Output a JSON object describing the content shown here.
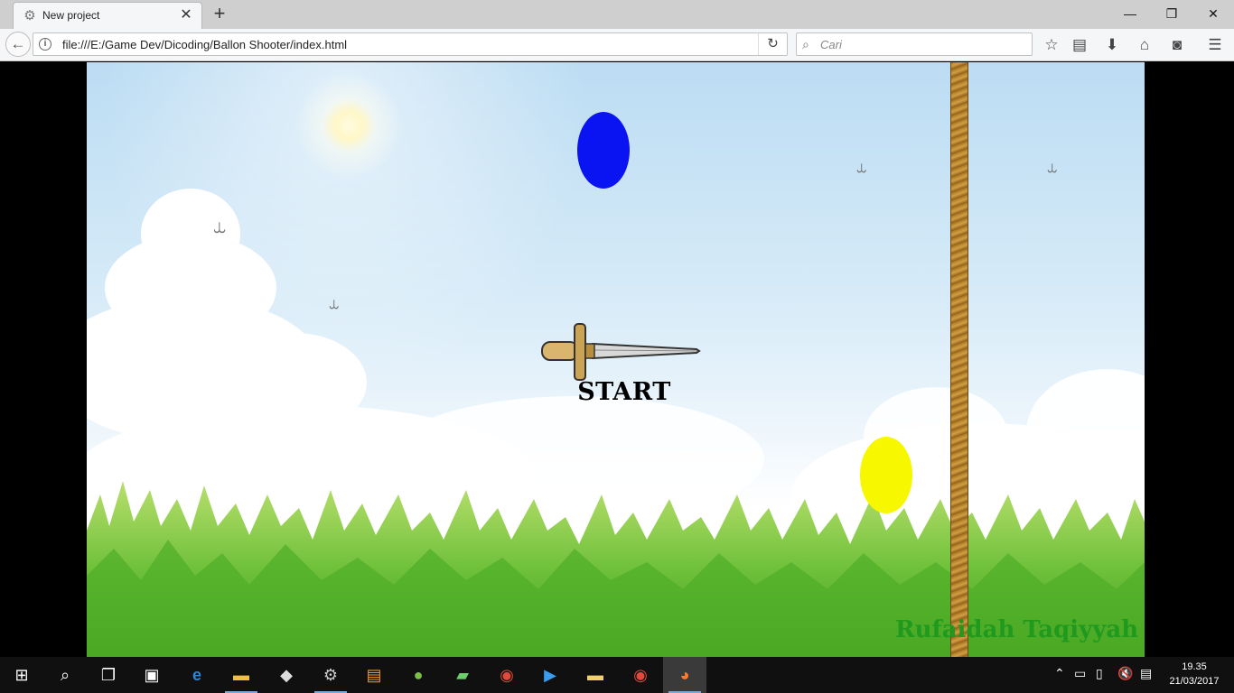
{
  "browser": {
    "tab_title": "New project",
    "tab_icon": "gear-icon",
    "url": "file:///E:/Game Dev/Dicoding/Ballon Shooter/index.html",
    "search_placeholder": "Cari",
    "toolbar_icons": [
      "star-icon",
      "reading-list-icon",
      "download-icon",
      "home-icon",
      "pocket-icon",
      "menu-icon"
    ]
  },
  "game": {
    "start_label": "START",
    "author": "Rufaidah Taqiyyah",
    "balloons": [
      {
        "color": "#0a14f2",
        "name": "blue"
      },
      {
        "color": "#f7f700",
        "name": "yellow"
      }
    ]
  },
  "taskbar": {
    "apps": [
      "windows-start-icon",
      "search-icon",
      "task-view-icon",
      "store-icon",
      "edge-icon",
      "file-explorer-icon",
      "unity-icon",
      "settings-icon",
      "sublime-icon",
      "game-icon",
      "app-icon",
      "chrome-icon",
      "media-player-icon",
      "folder-icon",
      "chrome-icon",
      "firefox-icon"
    ],
    "time": "19.35",
    "date": "21/03/2017"
  }
}
